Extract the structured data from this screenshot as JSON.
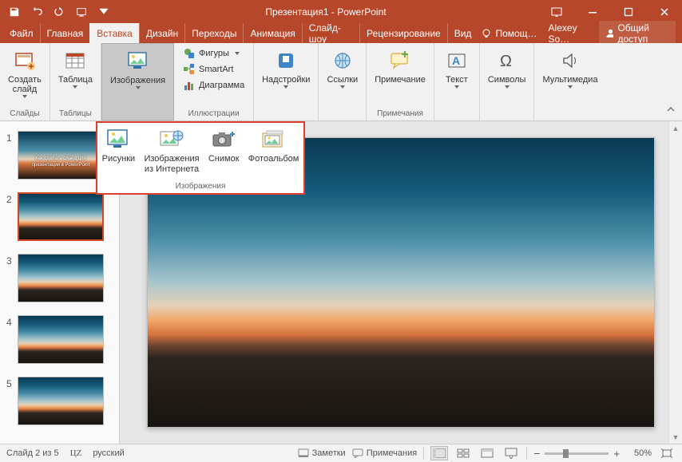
{
  "title": "Презентация1 - PowerPoint",
  "qat_dropdown_title": "Настройка панели быстрого доступа",
  "tabs": {
    "file": "Файл",
    "home": "Главная",
    "insert": "Вставка",
    "design": "Дизайн",
    "transitions": "Переходы",
    "animations": "Анимация",
    "slideshow": "Слайд-шоу",
    "review": "Рецензирование",
    "view": "Вид"
  },
  "help": "Помощ…",
  "user_name": "Alexey So…",
  "share": "Общий доступ",
  "ribbon": {
    "slides": {
      "new_slide": "Создать\nслайд",
      "group": "Слайды"
    },
    "tables": {
      "table": "Таблица",
      "group": "Таблицы"
    },
    "images": {
      "button": "Изображения"
    },
    "illustrations": {
      "shapes": "Фигуры",
      "smartart": "SmartArt",
      "chart": "Диаграмма",
      "group": "Иллюстрации"
    },
    "addins": {
      "button": "Надстройки"
    },
    "links": {
      "button": "Ссылки"
    },
    "comments": {
      "button": "Примечание",
      "group": "Примечания"
    },
    "text": {
      "button": "Текст"
    },
    "symbols": {
      "button": "Символы"
    },
    "media": {
      "button": "Мультимедиа"
    }
  },
  "dropdown": {
    "pictures": "Рисунки",
    "online": "Изображения\nиз Интернета",
    "screenshot": "Снимок",
    "album": "Фотоальбом",
    "group": "Изображения"
  },
  "thumbs": {
    "slide1_text": "Как сделать слайд для презентации в PowerPoint",
    "numbers": [
      "1",
      "2",
      "3",
      "4",
      "5"
    ]
  },
  "status": {
    "slide_of": "Слайд 2 из 5",
    "lang_icon": "ЦZ",
    "language": "русский",
    "notes": "Заметки",
    "comments": "Примечания",
    "zoom": "50%",
    "zoom_pos_pct": 28
  },
  "colors": {
    "accent": "#b7472a"
  }
}
